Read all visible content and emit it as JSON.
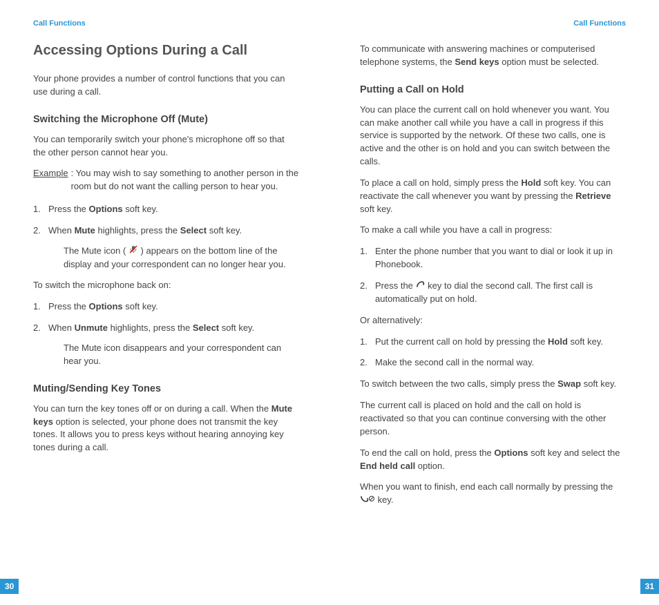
{
  "header": {
    "left": "Call Functions",
    "right": "Call Functions"
  },
  "left": {
    "title": "Accessing Options During a Call",
    "intro": "Your phone provides a number of control functions that you can use during a call.",
    "mute": {
      "heading": "Switching the Microphone Off (Mute)",
      "p1": "You can temporarily switch your phone's microphone off so that the other person cannot hear you.",
      "example_label": "Example",
      "example_body": ": You may wish to say something to another person in the room but do not want the calling person to hear you.",
      "s1_pre": "Press the ",
      "s1_b": "Options",
      "s1_post": " soft key.",
      "s2_pre": "When ",
      "s2_b1": "Mute",
      "s2_mid": " highlights, press the ",
      "s2_b2": "Select",
      "s2_post": " soft key.",
      "s2_sub": "The Mute icon ( ",
      "s2_sub2": " ) appears on the bottom line of the display and your correspondent can no longer hear you.",
      "back_on": "To switch the microphone back on:",
      "b1_pre": "Press the ",
      "b1_b": "Options",
      "b1_post": " soft key.",
      "b2_pre": "When ",
      "b2_b1": "Unmute",
      "b2_mid": " highlights, press the ",
      "b2_b2": "Select",
      "b2_post": " soft key.",
      "b2_sub": "The Mute icon disappears and your correspondent can hear you."
    },
    "tones": {
      "heading": "Muting/Sending Key Tones",
      "p1_pre": "You can turn the key tones off or on during a call. When the ",
      "p1_b": "Mute keys",
      "p1_post": " option is selected, your phone does not transmit the key tones. It allows you to press keys without hearing annoying key tones during a call."
    },
    "page_num": "30"
  },
  "right": {
    "top_pre": "To communicate with answering machines or computerised telephone systems, the ",
    "top_b": "Send keys",
    "top_post": " option must be selected.",
    "hold": {
      "heading": "Putting a Call on Hold",
      "p1": "You can place the current call on hold whenever you want. You can make another call while you have a call in progress if this service is supported by the network. Of these two calls, one is active and the other is on hold and you can switch between the calls.",
      "p2_pre": "To place a call on hold, simply press the ",
      "p2_b1": "Hold",
      "p2_mid": " soft key. You can reactivate the call whenever you want by pressing the ",
      "p2_b2": "Retrieve",
      "p2_post": " soft key.",
      "p3": "To make a call while you have a call in progress:",
      "s1": "Enter the phone number that you want to dial or look it up in Phonebook.",
      "s2_pre": "Press the ",
      "s2_post": " key to dial the second call. The first call is automatically put on hold.",
      "alt": "Or alternatively:",
      "a1_pre": "Put the current call on hold by pressing the ",
      "a1_b": "Hold",
      "a1_post": " soft key.",
      "a2": "Make the second call in the normal way.",
      "p4_pre": "To switch between the two calls, simply press the ",
      "p4_b": "Swap",
      "p4_post": " soft key.",
      "p5": "The current call is placed on hold and the call on hold is reactivated so that you can continue conversing with the other person.",
      "p6_pre": "To end the call on hold, press the ",
      "p6_b1": "Options",
      "p6_mid": " soft key and select the ",
      "p6_b2": "End held call",
      "p6_post": " option.",
      "p7_pre": "When you want to finish, end each call normally by pressing the ",
      "p7_post": " key."
    },
    "page_num": "31"
  }
}
